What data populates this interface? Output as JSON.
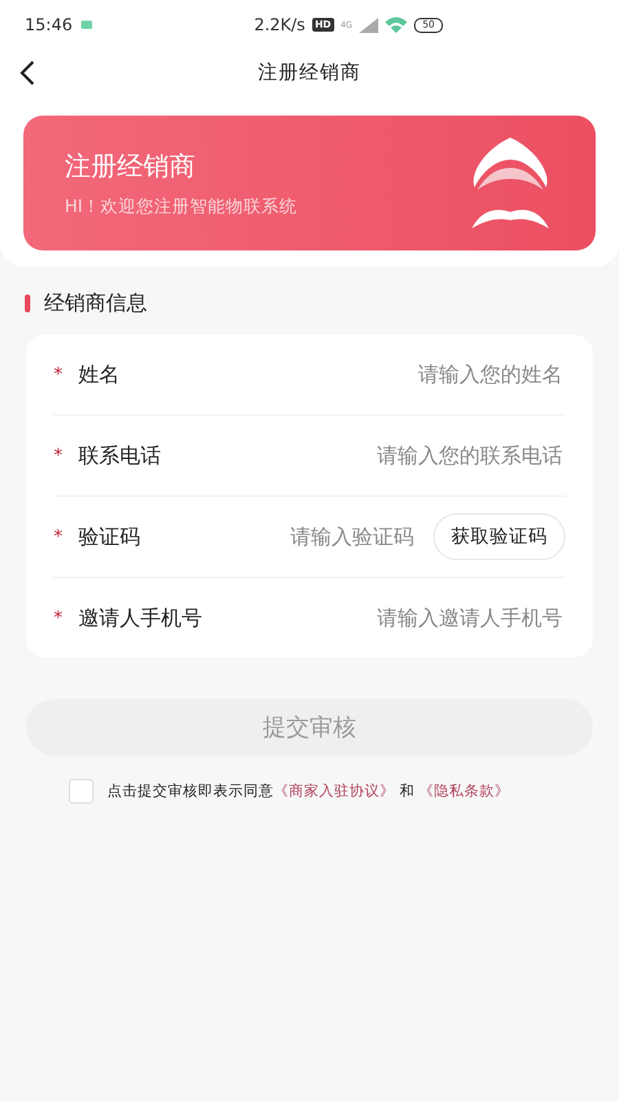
{
  "status_bar": {
    "time": "15:46",
    "net_speed": "2.2K/s",
    "hd_badge": "HD",
    "network": "4G",
    "battery": "50"
  },
  "header": {
    "title": "注册经销商"
  },
  "banner": {
    "title": "注册经销商",
    "subtitle": "HI！欢迎您注册智能物联系统"
  },
  "section": {
    "title": "经销商信息"
  },
  "fields": [
    {
      "label": "姓名",
      "required_mark": "*",
      "placeholder": "请输入您的姓名"
    },
    {
      "label": "联系电话",
      "required_mark": "*",
      "placeholder": "请输入您的联系电话"
    },
    {
      "label": "验证码",
      "required_mark": "*",
      "placeholder": "请输入验证码",
      "button": "获取验证码"
    },
    {
      "label": "邀请人手机号",
      "required_mark": "*",
      "placeholder": "请输入邀请人手机号"
    }
  ],
  "submit": {
    "label": "提交审核",
    "disabled": true
  },
  "agreement": {
    "checked": false,
    "text": "点击提交审核即表示同意",
    "links": [
      "《商家入驻协议》",
      "《隐私条款》"
    ],
    "joiner": "和"
  }
}
